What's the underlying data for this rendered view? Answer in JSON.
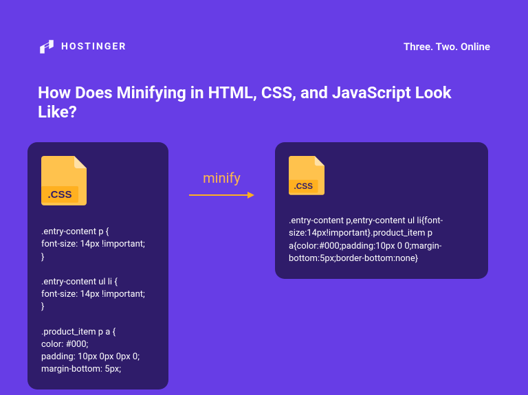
{
  "header": {
    "brand": "HOSTINGER",
    "tagline": "Three. Two. Online"
  },
  "title": "How Does Minifying in HTML, CSS, and JavaScript Look Like?",
  "arrow": {
    "label": "minify"
  },
  "left": {
    "file_label": ".CSS",
    "code": ".entry-content p {\nfont-size: 14px !important;\n}\n\n.entry-content ul li {\nfont-size: 14px !important;\n}\n\n.product_item p a {\ncolor: #000;\npadding: 10px 0px 0px 0;\nmargin-bottom: 5px;"
  },
  "right": {
    "file_label": ".CSS",
    "code": ".entry-content p,entry-content ul li{font-size:14px!important}.product_item p a{color:#000;padding:10px 0 0;margin-bottom:5px;border-bottom:none}"
  }
}
